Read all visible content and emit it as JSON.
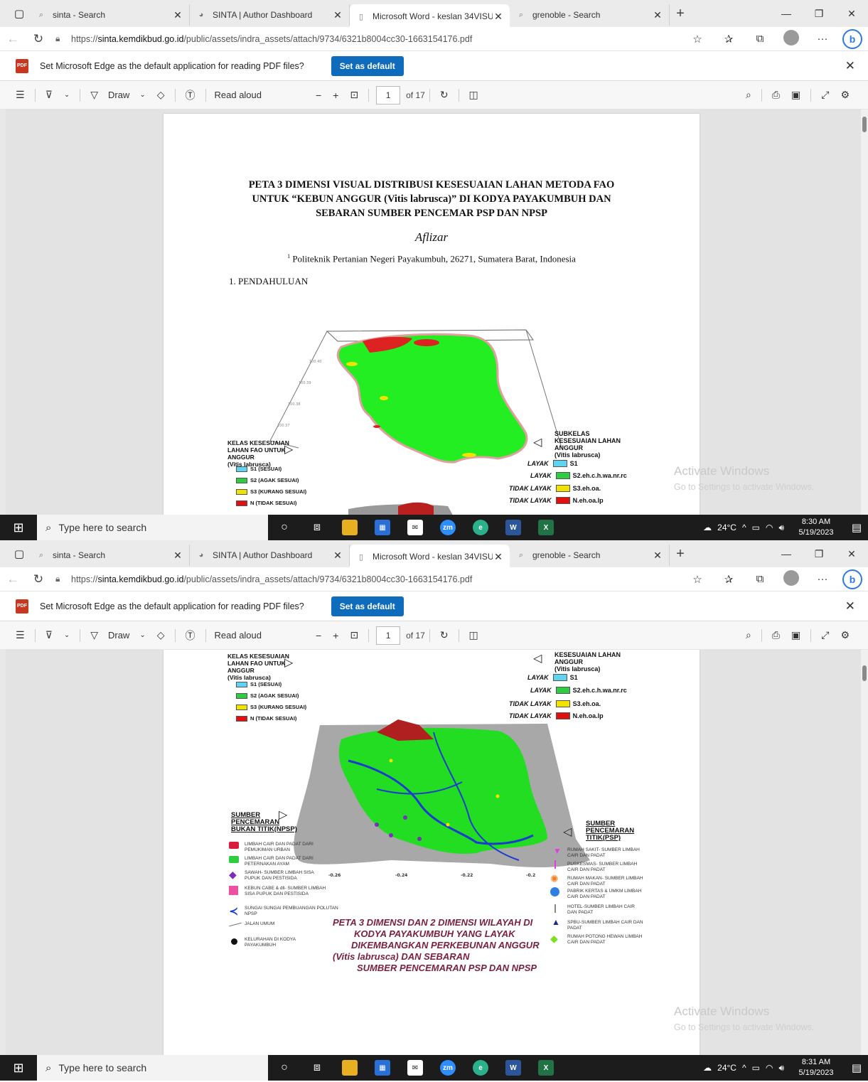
{
  "browser": {
    "tabs": [
      {
        "label": "sinta - Search",
        "icon": "search-icon"
      },
      {
        "label": "SINTA | Author Dashboard",
        "icon": "sinta-icon"
      },
      {
        "label": "Microsoft Word - keslan 34VISUA",
        "icon": "document-icon"
      },
      {
        "label": "grenoble - Search",
        "icon": "search-icon"
      }
    ],
    "url_prefix": "https://",
    "url_host": "sinta.kemdikbud.go.id",
    "url_path": "/public/assets/indra_assets/attach/9734/6321b8004cc30-1663154176.pdf"
  },
  "infobar": {
    "message": "Set Microsoft Edge as the default application for reading PDF files?",
    "button": "Set as default"
  },
  "pdf_toolbar": {
    "draw": "Draw",
    "read_aloud": "Read aloud",
    "page": "1",
    "of_pages": "of 17"
  },
  "document": {
    "title_line1": "PETA 3 DIMENSI VISUAL DISTRIBUSI KESESUAIAN LAHAN METODA FAO",
    "title_line2": "UNTUK “KEBUN  ANGGUR (Vitis labrusca)” DI KODYA PAYAKUMBUH DAN",
    "title_line3": "SEBARAN SUMBER PENCEMAR PSP DAN NPSP",
    "author": "Aflizar",
    "affil_sup": "1",
    "affiliation": "Politeknik Pertanian Negeri Payakumbuh,  26271, Sumatera Barat, Indonesia",
    "section": "1. PENDAHULUAN"
  },
  "map_legend": {
    "left_title": [
      "KELAS KESESUAIAN",
      "LAHAN FAO UNTUK",
      "ANGGUR",
      "(Vitis labrusca)"
    ],
    "left_items": [
      {
        "label": "S1 (SESUAI)",
        "color": "#5fd4f0"
      },
      {
        "label": "S2 (AGAK SESUAI)",
        "color": "#2ecc40"
      },
      {
        "label": "S3 (KURANG SESUAI)",
        "color": "#f2e200"
      },
      {
        "label": "N (TIDAK SESUAI)",
        "color": "#e01010"
      }
    ],
    "right_title": [
      "SUBKELAS",
      "KESESUAIAN LAHAN",
      "ANGGUR",
      "(Vitis labrusca)"
    ],
    "right_title_crop": [
      "KESESUAIAN LAHAN",
      "ANGGUR",
      "(Vitis labrusca)"
    ],
    "right_items": [
      {
        "class": "LAYAK",
        "label": "S1",
        "color": "#5fd4f0"
      },
      {
        "class": "LAYAK",
        "label": "S2.eh.c.h.wa.nr.rc",
        "color": "#2ecc40"
      },
      {
        "class": "TIDAK LAYAK",
        "label": "S3.eh.oa.",
        "color": "#f2e200"
      },
      {
        "class": "TIDAK LAYAK",
        "label": "N.eh.oa.lp",
        "color": "#e01010"
      }
    ]
  },
  "map2": {
    "npsp_title": [
      "SUMBER",
      "PENCEMARAN",
      "BUKAN TITIK(NPSP)"
    ],
    "psp_title": [
      "SUMBER",
      "PENCEMARAN",
      "TITIK(PSP)"
    ],
    "npsp_items": [
      {
        "text": "LIMBAH CAIR DAN PADAT DARI PEMUKIMAN URBAN",
        "color": "#d91e3c"
      },
      {
        "text": "LIMBAH CAIR DAN PADAT DARI PETERNAKAN AYAM",
        "color": "#2ecc40"
      },
      {
        "text": "SAWAH- SUMBER LIMBAH SISA PUPUK DAN PESTISIDA",
        "color": "#7b2fbe"
      },
      {
        "text": "KEBUN CABE & dll- SUMBER LIMBAH SISA PUPUK DAN PESTISIDA",
        "color": "#f04ea0"
      },
      {
        "text": "SUNGAI SUNGAI PEMBUANGAN POLUTAN NPSP",
        "color": "#1a3ccf"
      },
      {
        "text": "JALAN UMUM",
        "color": "#666666"
      },
      {
        "text": "KELURAHAN DI KODYA PAYAKUMBUH",
        "color": "#111111"
      }
    ],
    "psp_items": [
      {
        "text": "RUMAH SAKIT- SUMBER LIMBAH CAIR DAN PADAT",
        "color": "#e040e0"
      },
      {
        "text": "PUSKESMAS- SUMBER LIMBAH CAIR DAN PADAT",
        "color": "#e040e0"
      },
      {
        "text": "RUMAH MAKAN- SUMBER LIMBAH CAIR DAN PADAT",
        "color": "#f08020"
      },
      {
        "text": "PABRIK KERTAS & UMKM LIMBAH CAIR DAN PADAT",
        "color": "#2f7fe0"
      },
      {
        "text": "HOTEL-SUMBER LIMBAH CAIR DAN PADAT",
        "color": "#888888"
      },
      {
        "text": "SPBU-SUMBER LIMBAH CAIR DAN PADAT",
        "color": "#1a2a8a"
      },
      {
        "text": "RUMAH POTONG HEWAN LIMBAH CAIR DAN PADAT",
        "color": "#7ce020"
      }
    ],
    "title": [
      "PETA 3 DIMENSI DAN 2 DIMENSI WILAYAH DI",
      "KODYA PAYAKUMBUH  YANG LAYAK",
      "DIKEMBANGKAN PERKEBUNAN  ANGGUR",
      "(Vitis labrusca) DAN SEBARAN",
      "SUMBER PENCEMARAN PSP DAN NPSP"
    ],
    "axis_ticks": [
      "-0.26",
      "-0.24",
      "-0.22",
      "-0.2"
    ]
  },
  "watermark": {
    "title": "Activate Windows",
    "subtitle": "Go to Settings to activate Windows."
  },
  "taskbar": {
    "search_placeholder": "Type here to search",
    "weather": "24°C",
    "time1": "8:30 AM",
    "time2": "8:31 AM",
    "date": "5/19/2023",
    "notif_count": "2"
  },
  "colors": {
    "accent": "#0f6cbd",
    "pdf_red": "#c8371f",
    "taskbar": "#1c1c1c",
    "map_green": "#22ee22"
  }
}
